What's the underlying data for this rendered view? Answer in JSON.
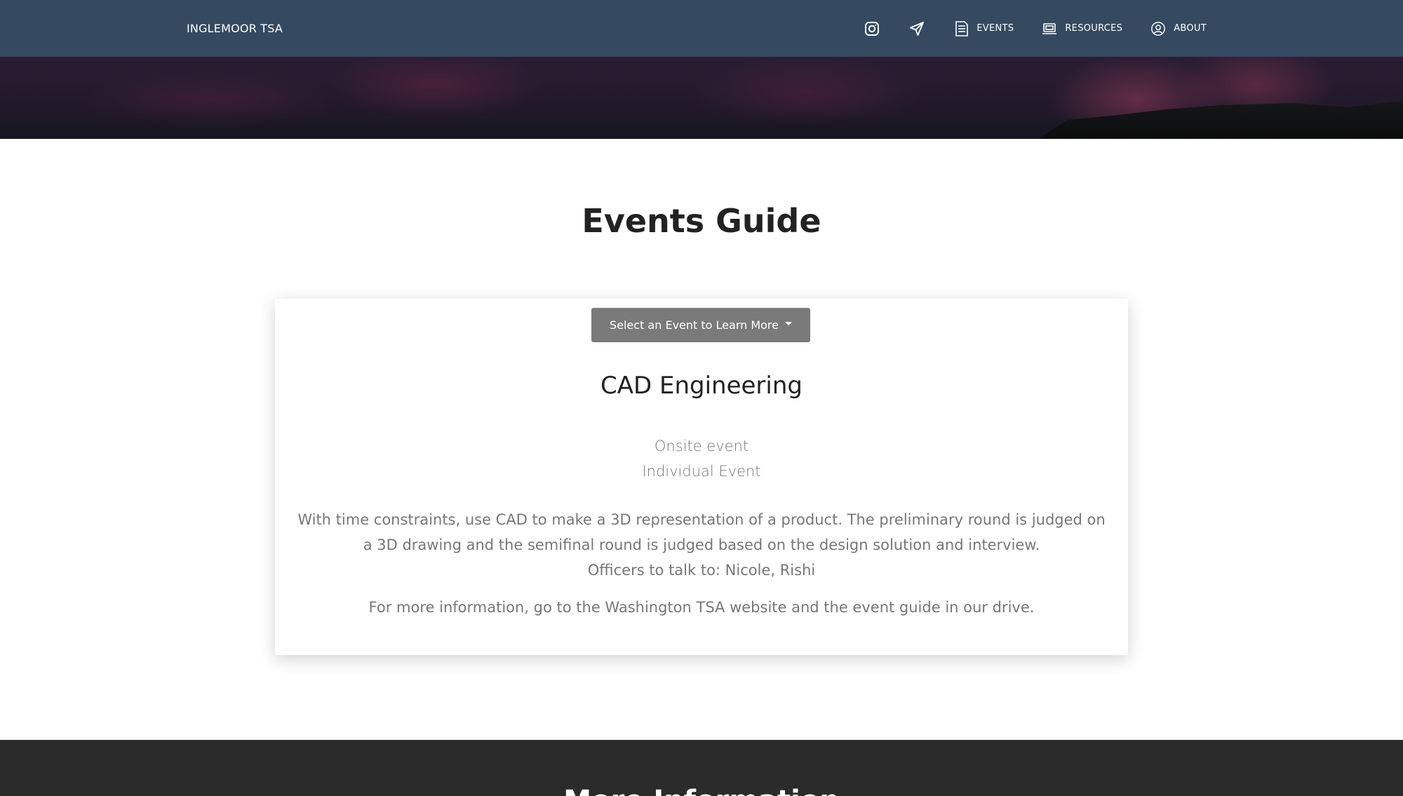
{
  "navbar": {
    "brand": "INGLEMOOR TSA",
    "icons": [
      "instagram-icon",
      "send-icon"
    ],
    "links": [
      {
        "label": "EVENTS",
        "icon": "document-icon"
      },
      {
        "label": "RESOURCES",
        "icon": "laptop-icon"
      },
      {
        "label": "ABOUT",
        "icon": "user-circle-icon"
      }
    ],
    "background": "#354a61"
  },
  "page": {
    "title": "Events Guide"
  },
  "event_card": {
    "dropdown_label": "Select an Event to Learn More",
    "event_name": "CAD Engineering",
    "location": "Onsite event",
    "type": "Individual Event",
    "description": "With time constraints, use CAD to make a 3D representation of a product. The preliminary round is judged on a 3D drawing and the semifinal round is judged based on the design solution and interview.",
    "officers": "Officers to talk to: Nicole, Rishi",
    "more_info": "For more information, go to the Washington TSA website and the event guide in our drive."
  },
  "footer": {
    "title": "More Information",
    "background": "#2b2b2b"
  }
}
